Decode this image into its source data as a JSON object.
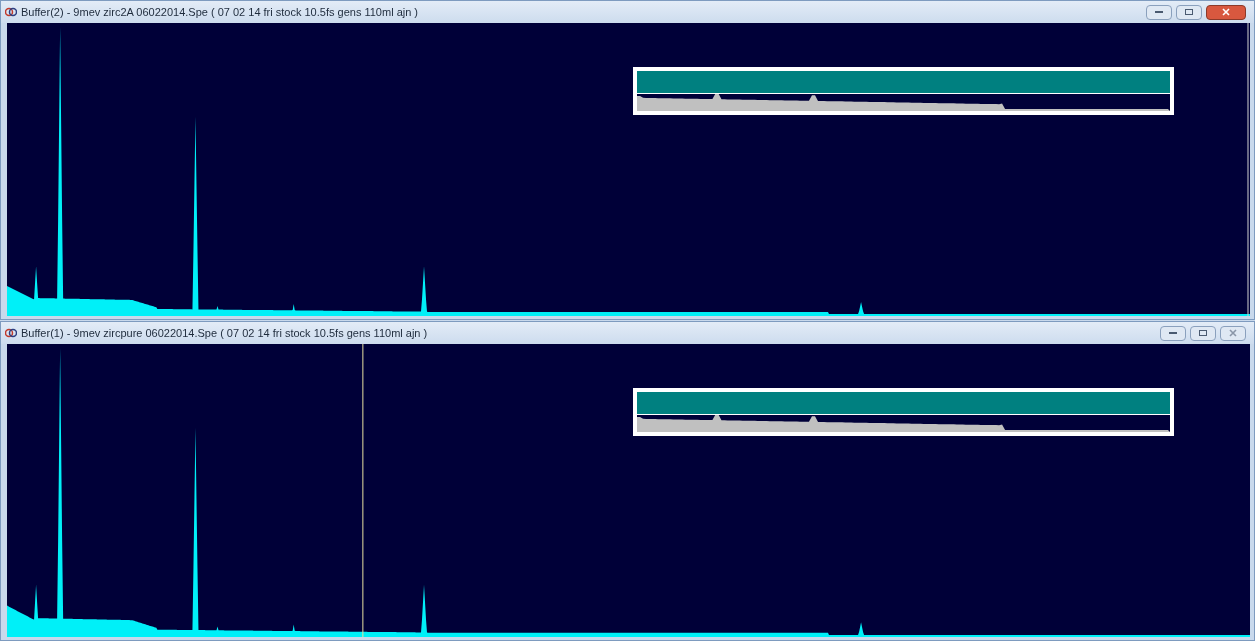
{
  "windows": [
    {
      "title": "Buffer(2) - 9mev zirc2A 06022014.Spe ( 07 02 14 fri stock 10.5fs gens 110ml ajn )",
      "active": true
    },
    {
      "title": "Buffer(1) - 9mev zircpure 06022014.Spe ( 07 02 14 fri stock 10.5fs gens 110ml ajn )",
      "active": false
    }
  ]
}
